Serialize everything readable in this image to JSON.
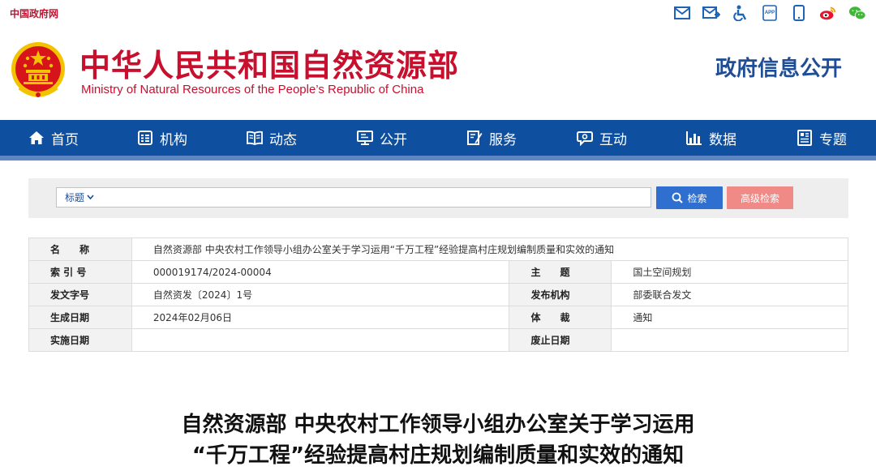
{
  "topbar": {
    "site_link": "中国政府网",
    "icons": [
      "email-icon",
      "mailbox-icon",
      "accessibility-icon",
      "app-icon",
      "mobile-icon",
      "weibo-icon",
      "wechat-icon"
    ],
    "app_label": "APP"
  },
  "header": {
    "title": "中华人民共和国自然资源部",
    "subtitle": "Ministry of Natural Resources of the People’s Republic of China",
    "section": "政府信息公开"
  },
  "nav": {
    "items": [
      {
        "label": "首页",
        "icon": "home-icon"
      },
      {
        "label": "机构",
        "icon": "org-icon"
      },
      {
        "label": "动态",
        "icon": "book-icon"
      },
      {
        "label": "公开",
        "icon": "monitor-icon"
      },
      {
        "label": "服务",
        "icon": "edit-icon"
      },
      {
        "label": "互动",
        "icon": "chat-icon"
      },
      {
        "label": "数据",
        "icon": "bar-chart-icon"
      },
      {
        "label": "专题",
        "icon": "topic-icon"
      }
    ]
  },
  "search": {
    "scope": "标题",
    "value": "",
    "search_label": "检索",
    "advanced_label": "高级检索"
  },
  "meta": {
    "name_label": "名　　称",
    "name_value": "自然资源部 中央农村工作领导小组办公室关于学习运用“千万工程”经验提高村庄规划编制质量和实效的通知",
    "index_label": "索 引 号",
    "index_value": "000019174/2024-00004",
    "topic_label": "主　　题",
    "topic_value": "国土空间规划",
    "docno_label": "发文字号",
    "docno_value": "自然资发〔2024〕1号",
    "publisher_label": "发布机构",
    "publisher_value": "部委联合发文",
    "created_label": "生成日期",
    "created_value": "2024年02月06日",
    "genre_label": "体　　裁",
    "genre_value": "通知",
    "effective_label": "实施日期",
    "effective_value": "",
    "expiry_label": "废止日期",
    "expiry_value": ""
  },
  "article": {
    "title_line1": "自然资源部 中央农村工作领导小组办公室关于学习运用",
    "title_line2": "“千万工程”经验提高村庄规划编制质量和实效的通知"
  },
  "colors": {
    "brand_red": "#c8102e",
    "nav_blue": "#0f4fa0",
    "search_blue": "#2e6fd0",
    "advanced_pink": "#ef8a86",
    "section_blue": "#1f4e96"
  }
}
